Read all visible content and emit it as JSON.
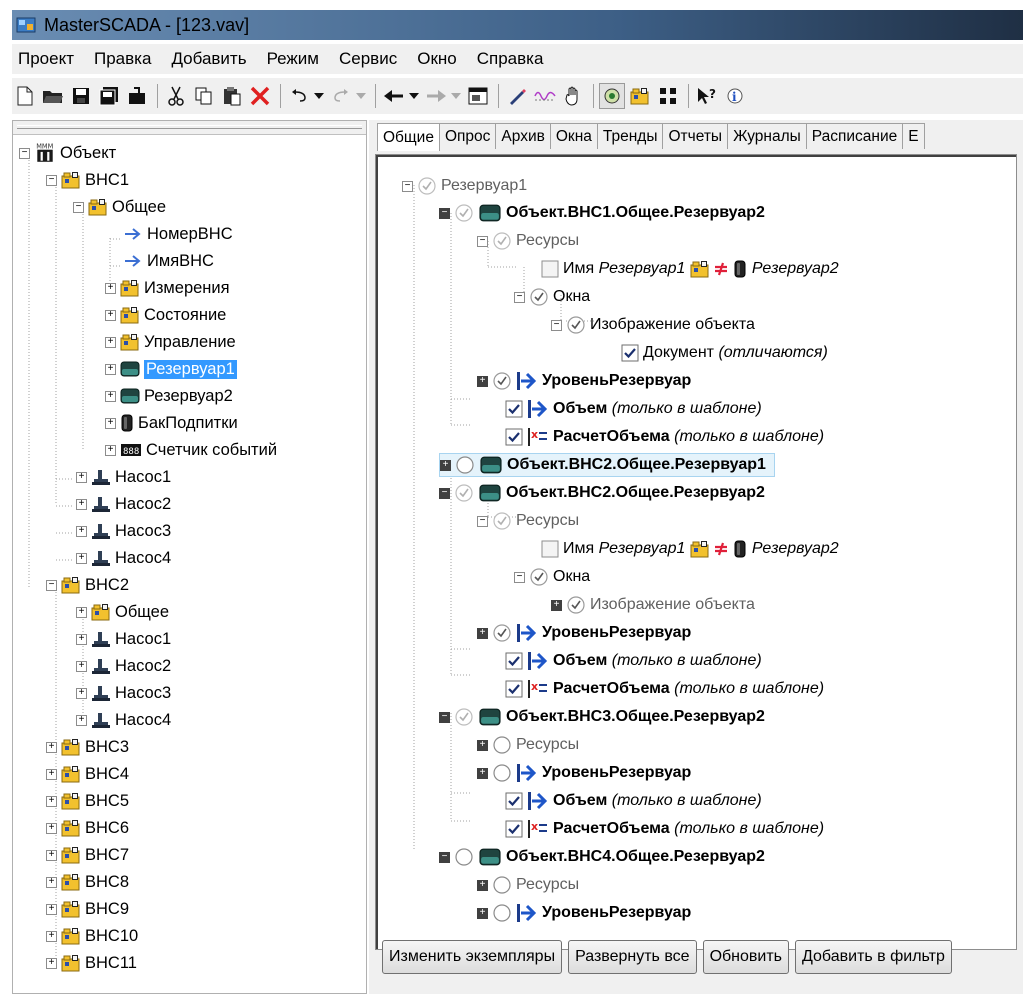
{
  "window": {
    "title": "MasterSCADA - [123.vav]"
  },
  "menu": [
    "Проект",
    "Правка",
    "Добавить",
    "Режим",
    "Сервис",
    "Окно",
    "Справка"
  ],
  "left_tree": {
    "root": "Объект",
    "vns1": "ВНС1",
    "obshchee": "Общее",
    "nomer": "НомерВНС",
    "imya": "ИмяВНС",
    "izmereniya": "Измерения",
    "sostoyanie": "Состояние",
    "upravlenie": "Управление",
    "rez1": "Резервуар1",
    "rez2": "Резервуар2",
    "bak": "БакПодпитки",
    "schetchik": "Счетчик событий",
    "nasos1": "Насос1",
    "nasos2": "Насос2",
    "nasos3": "Насос3",
    "nasos4": "Насос4",
    "vns2": "ВНС2",
    "vns3": "ВНС3",
    "vns4": "ВНС4",
    "vns5": "ВНС5",
    "vns6": "ВНС6",
    "vns7": "ВНС7",
    "vns8": "ВНС8",
    "vns9": "ВНС9",
    "vns10": "ВНС10",
    "vns11": "ВНС11"
  },
  "tabs": [
    "Общие",
    "Опрос",
    "Архив",
    "Окна",
    "Тренды",
    "Отчеты",
    "Журналы",
    "Расписание",
    "Е"
  ],
  "compare": {
    "root": "Резервуар1",
    "obj1": "Объект.ВНС1.Общее.Резервуар2",
    "obj2a": "Объект.ВНС2.Общее.Резервуар1",
    "obj2b": "Объект.ВНС2.Общее.Резервуар2",
    "obj3": "Объект.ВНС3.Общее.Резервуар2",
    "obj4": "Объект.ВНС4.Общее.Резервуар2",
    "resursy": "Ресурсы",
    "imya": "Имя",
    "imya_left": "Резервуар1",
    "imya_right": "Резервуар2",
    "okna": "Окна",
    "izobr": "Изображение объекта",
    "dokument": "Документ",
    "dokument_note": "(отличаются)",
    "uroven": "УровеньРезервуар",
    "obem": "Объем",
    "raschet": "РасчетОбъема",
    "only_template": "(только в шаблоне)"
  },
  "buttons": {
    "change": "Изменить экземпляры",
    "expand": "Развернуть все",
    "refresh": "Обновить",
    "add_filter": "Добавить в фильтр"
  },
  "colors": {
    "selection": "#3399ff",
    "highlight_row": "#e5f3fb",
    "arrow_blue": "#1e56c8",
    "not_equal_red": "#e0203a"
  }
}
